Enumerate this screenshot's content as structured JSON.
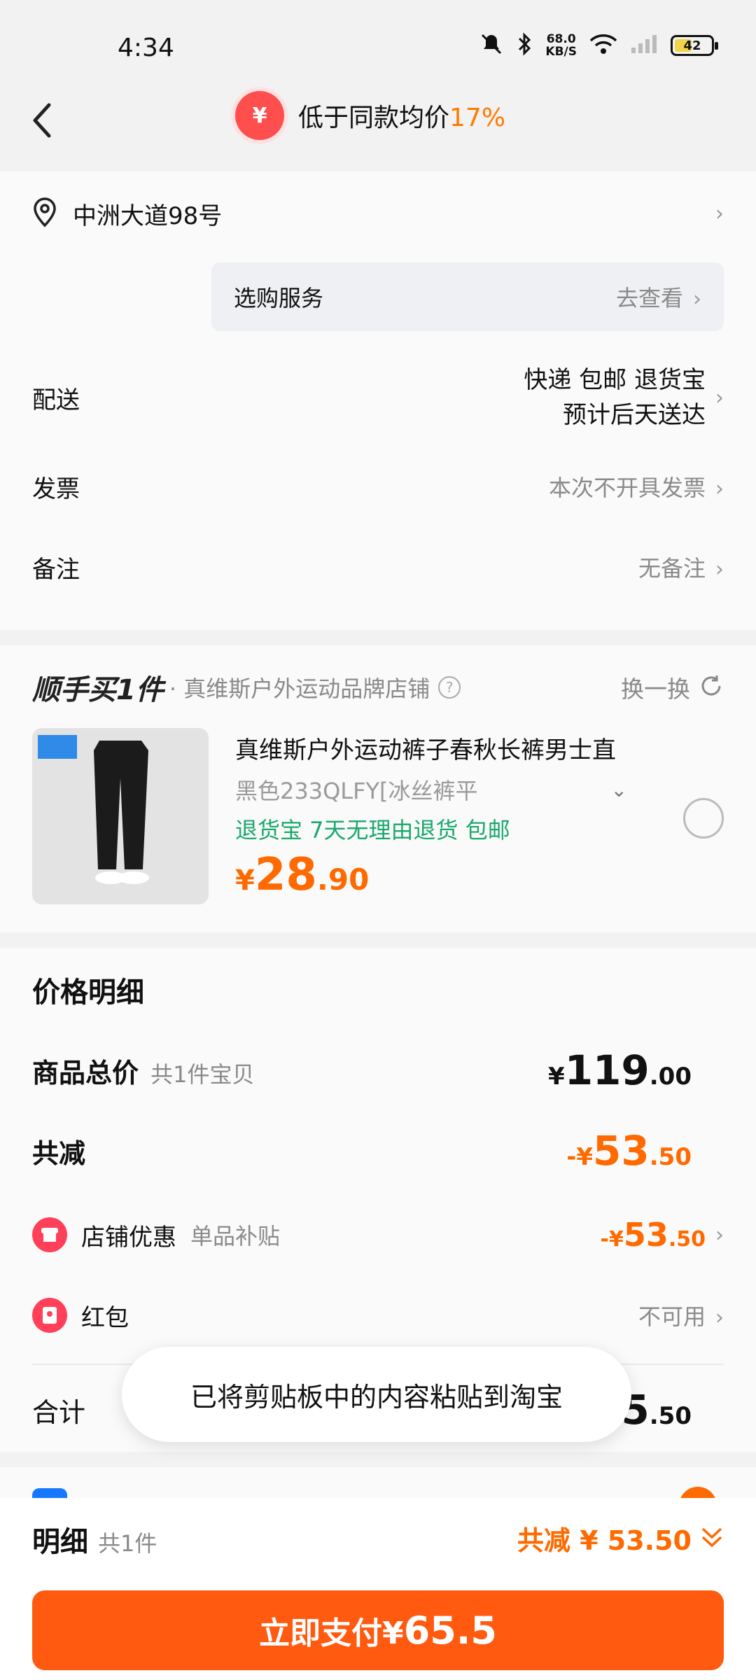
{
  "status_bar": {
    "time": "4:34",
    "net_speed_top": "68.0",
    "net_speed_unit": "KB/S",
    "battery": "42"
  },
  "header": {
    "badge_symbol": "¥",
    "title": "低于同款均价",
    "pct": "17%"
  },
  "address": {
    "text": "中洲大道98号"
  },
  "service": {
    "label": "选购服务",
    "action": "去查看"
  },
  "delivery": {
    "label": "配送",
    "line1": "快递 包邮 退货宝",
    "line2": "预计后天送达"
  },
  "invoice": {
    "label": "发票",
    "value": "本次不开具发票"
  },
  "remark": {
    "label": "备注",
    "value": "无备注"
  },
  "addon": {
    "logo": "顺手买1件",
    "store": "· 真维斯户外运动品牌店铺",
    "swap": "换一换",
    "title": "真维斯户外运动裤子春秋长裤男士直",
    "sku": "黑色233QLFY[冰丝裤平",
    "tags": "退货宝  7天无理由退货  包邮",
    "price_symbol": "¥",
    "price_int": "28",
    "price_dec": ".90"
  },
  "price_detail": {
    "title": "价格明细",
    "total_label": "商品总价",
    "total_sub": "共1件宝贝",
    "total_symbol": "¥",
    "total_int": "119",
    "total_dec": ".00",
    "reduce_label": "共减",
    "reduce_prefix": "-¥",
    "reduce_int": "53",
    "reduce_dec": ".50",
    "store_label": "店铺优惠",
    "store_sub": "单品补贴",
    "store_prefix": "-¥",
    "store_int": "53",
    "store_dec": ".50",
    "redpack_label": "红包",
    "redpack_value": "不可用",
    "sum_label": "合计",
    "sum_int": "65",
    "sum_dec": ".50"
  },
  "toast": {
    "text": "已将剪贴板中的内容粘贴到淘宝"
  },
  "bottom_bar": {
    "detail_label": "明细",
    "detail_sub": "共1件",
    "reduce_text": "共减 ¥ 53.50",
    "pay_label": "立即支付¥",
    "pay_amount": "65.5"
  },
  "colors": {
    "accent": "#ff6a00",
    "pay_button": "#ff5a0f",
    "green": "#1aa86c",
    "badge": "#ff4e4e"
  }
}
